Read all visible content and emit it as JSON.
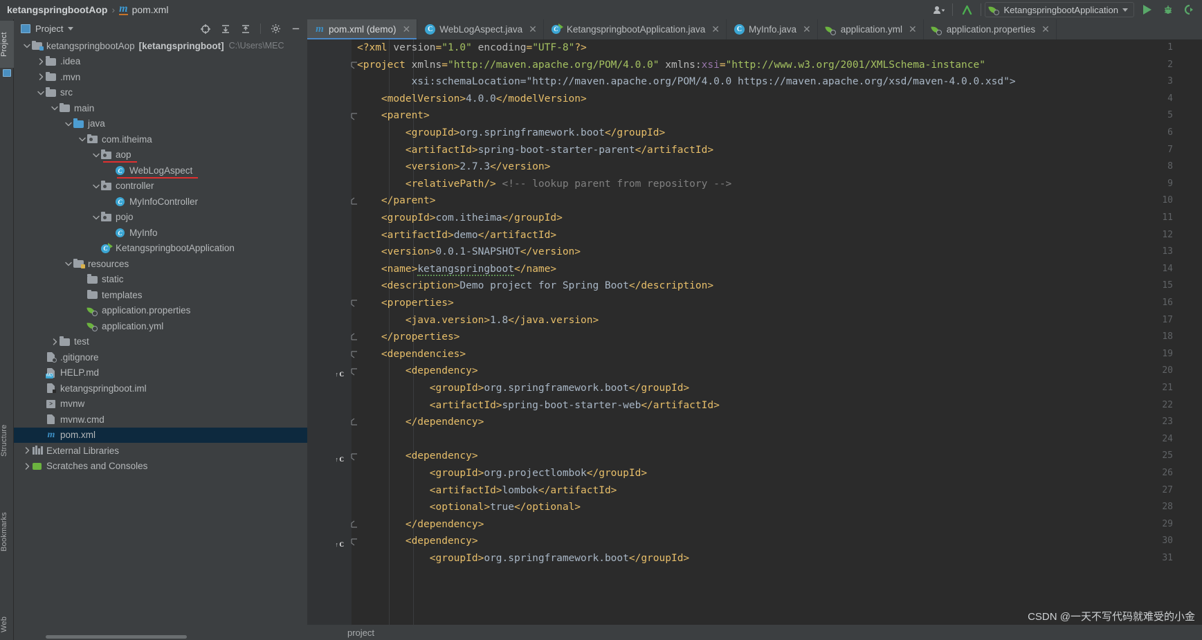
{
  "topbar": {
    "breadcrumb": {
      "project": "ketangspringbootAop",
      "separator": "›",
      "file": "pom.xml",
      "file_icon": "maven-m-icon"
    },
    "account_icon": "user-account-icon",
    "updates_icon": "update-arrow-icon",
    "run_config": {
      "label": "KetangspringbootApplication",
      "icon": "spring-leaf-icon",
      "dropdown_icon": "chevron-down-icon"
    },
    "run_icon": "run-play-icon",
    "debug_icon": "debug-bug-icon",
    "run_with_coverage_icon": "run-coverage-icon"
  },
  "left_strip": {
    "tabs": [
      {
        "label": "Project",
        "icon": "project-folder-icon",
        "selected": true
      },
      {
        "label": "Structure",
        "icon": "structure-icon",
        "selected": false
      },
      {
        "label": "Bookmarks",
        "icon": "bookmark-icon",
        "selected": false
      },
      {
        "label": "Web",
        "icon": "web-globe-icon",
        "selected": false
      }
    ]
  },
  "project_panel": {
    "title": "Project",
    "dropdown_icon": "chevron-down-icon",
    "toolbar_icons": [
      "locate-target-icon",
      "expand-all-icon",
      "collapse-all-icon",
      "gear-icon",
      "minimize-icon"
    ],
    "tree": [
      {
        "indent": 0,
        "arrow": "down",
        "icon": "module-folder-icon",
        "name": "ketangspringbootAop",
        "bold_suffix": "[ketangspringboot]",
        "path": "C:\\Users\\MEC",
        "selected": false
      },
      {
        "indent": 1,
        "arrow": "right",
        "icon": "folder-icon",
        "name": ".idea",
        "selected": false
      },
      {
        "indent": 1,
        "arrow": "right",
        "icon": "folder-icon",
        "name": ".mvn",
        "selected": false
      },
      {
        "indent": 1,
        "arrow": "down",
        "icon": "folder-icon",
        "name": "src",
        "selected": false
      },
      {
        "indent": 2,
        "arrow": "down",
        "icon": "folder-icon",
        "name": "main",
        "selected": false
      },
      {
        "indent": 3,
        "arrow": "down",
        "icon": "source-folder-icon",
        "name": "java",
        "selected": false
      },
      {
        "indent": 4,
        "arrow": "down",
        "icon": "package-icon",
        "name": "com.itheima",
        "selected": false
      },
      {
        "indent": 5,
        "arrow": "down",
        "icon": "package-icon",
        "name": "aop",
        "selected": false,
        "red_underline": true
      },
      {
        "indent": 6,
        "arrow": "none",
        "icon": "java-class-icon",
        "name": "WebLogAspect",
        "selected": false,
        "red_underline": true
      },
      {
        "indent": 5,
        "arrow": "down",
        "icon": "package-icon",
        "name": "controller",
        "selected": false
      },
      {
        "indent": 6,
        "arrow": "none",
        "icon": "java-class-icon",
        "name": "MyInfoController",
        "selected": false
      },
      {
        "indent": 5,
        "arrow": "down",
        "icon": "package-icon",
        "name": "pojo",
        "selected": false
      },
      {
        "indent": 6,
        "arrow": "none",
        "icon": "java-class-icon",
        "name": "MyInfo",
        "selected": false
      },
      {
        "indent": 5,
        "arrow": "none",
        "icon": "spring-boot-run-icon",
        "name": "KetangspringbootApplication",
        "selected": false
      },
      {
        "indent": 3,
        "arrow": "down",
        "icon": "resources-folder-icon",
        "name": "resources",
        "selected": false
      },
      {
        "indent": 4,
        "arrow": "none",
        "icon": "folder-icon",
        "name": "static",
        "selected": false
      },
      {
        "indent": 4,
        "arrow": "none",
        "icon": "folder-icon",
        "name": "templates",
        "selected": false
      },
      {
        "indent": 4,
        "arrow": "none",
        "icon": "spring-config-icon",
        "name": "application.properties",
        "selected": false
      },
      {
        "indent": 4,
        "arrow": "none",
        "icon": "spring-config-icon",
        "name": "application.yml",
        "selected": false
      },
      {
        "indent": 2,
        "arrow": "right",
        "icon": "folder-icon",
        "name": "test",
        "selected": false
      },
      {
        "indent": 1,
        "arrow": "none",
        "icon": "gitignore-icon",
        "name": ".gitignore",
        "selected": false
      },
      {
        "indent": 1,
        "arrow": "none",
        "icon": "markdown-icon",
        "name": "HELP.md",
        "selected": false
      },
      {
        "indent": 1,
        "arrow": "none",
        "icon": "iml-file-icon",
        "name": "ketangspringboot.iml",
        "selected": false
      },
      {
        "indent": 1,
        "arrow": "none",
        "icon": "shell-script-icon",
        "name": "mvnw",
        "selected": false
      },
      {
        "indent": 1,
        "arrow": "none",
        "icon": "cmd-file-icon",
        "name": "mvnw.cmd",
        "selected": false
      },
      {
        "indent": 1,
        "arrow": "none",
        "icon": "maven-m-icon",
        "name": "pom.xml",
        "selected": true
      },
      {
        "indent": 0,
        "arrow": "right",
        "icon": "external-libraries-icon",
        "name": "External Libraries",
        "selected": false
      },
      {
        "indent": 0,
        "arrow": "right",
        "icon": "scratches-icon",
        "name": "Scratches and Consoles",
        "selected": false
      }
    ]
  },
  "editor": {
    "tabs": [
      {
        "label": "pom.xml (demo)",
        "icon": "maven-m-icon",
        "active": true,
        "close_icon": "close-icon"
      },
      {
        "label": "WebLogAspect.java",
        "icon": "java-class-icon",
        "active": false,
        "close_icon": "close-icon"
      },
      {
        "label": "KetangspringbootApplication.java",
        "icon": "spring-boot-run-icon",
        "active": false,
        "close_icon": "close-icon"
      },
      {
        "label": "MyInfo.java",
        "icon": "java-class-icon",
        "active": false,
        "close_icon": "close-icon"
      },
      {
        "label": "application.yml",
        "icon": "spring-config-icon",
        "active": false,
        "close_icon": "close-icon"
      },
      {
        "label": "application.properties",
        "icon": "spring-config-icon",
        "active": false,
        "close_icon": "close-icon"
      }
    ],
    "first_line": 1,
    "last_line": 31,
    "gutter_markers": [
      {
        "line": 20,
        "icon": "spring-bean-nav-icon"
      },
      {
        "line": 25,
        "icon": "spring-bean-nav-icon"
      },
      {
        "line": 30,
        "icon": "spring-bean-nav-icon"
      }
    ],
    "folds": [
      {
        "line": 2,
        "type": "open"
      },
      {
        "line": 5,
        "type": "open"
      },
      {
        "line": 10,
        "type": "close"
      },
      {
        "line": 16,
        "type": "open"
      },
      {
        "line": 18,
        "type": "close"
      },
      {
        "line": 19,
        "type": "open"
      },
      {
        "line": 20,
        "type": "open"
      },
      {
        "line": 23,
        "type": "close"
      },
      {
        "line": 25,
        "type": "open"
      },
      {
        "line": 29,
        "type": "close"
      },
      {
        "line": 30,
        "type": "open"
      }
    ],
    "code_lines": [
      "<?xml version=\"1.0\" encoding=\"UTF-8\"?>",
      "<project xmlns=\"http://maven.apache.org/POM/4.0.0\" xmlns:xsi=\"http://www.w3.org/2001/XMLSchema-instance\"",
      "         xsi:schemaLocation=\"http://maven.apache.org/POM/4.0.0 https://maven.apache.org/xsd/maven-4.0.0.xsd\">",
      "    <modelVersion>4.0.0</modelVersion>",
      "    <parent>",
      "        <groupId>org.springframework.boot</groupId>",
      "        <artifactId>spring-boot-starter-parent</artifactId>",
      "        <version>2.7.3</version>",
      "        <relativePath/> <!-- lookup parent from repository -->",
      "    </parent>",
      "    <groupId>com.itheima</groupId>",
      "    <artifactId>demo</artifactId>",
      "    <version>0.0.1-SNAPSHOT</version>",
      "    <name>ketangspringboot</name>",
      "    <description>Demo project for Spring Boot</description>",
      "    <properties>",
      "        <java.version>1.8</java.version>",
      "    </properties>",
      "    <dependencies>",
      "        <dependency>",
      "            <groupId>org.springframework.boot</groupId>",
      "            <artifactId>spring-boot-starter-web</artifactId>",
      "        </dependency>",
      "",
      "        <dependency>",
      "            <groupId>org.projectlombok</groupId>",
      "            <artifactId>lombok</artifactId>",
      "            <optional>true</optional>",
      "        </dependency>",
      "        <dependency>",
      "            <groupId>org.springframework.boot</groupId>"
    ]
  },
  "status_bar": {
    "breadcrumb": "project"
  },
  "watermark": {
    "text": "CSDN @一天不写代码就难受的小金"
  },
  "colors": {
    "background": "#3c3f41",
    "editor_background": "#2b2b2b",
    "selection": "#0d293e",
    "accent_blue": "#4a88c7",
    "tag": "#e8bf6a",
    "string": "#a5c261",
    "text": "#a9b7c6",
    "comment": "#808080",
    "namespace": "#9876aa",
    "spring_green": "#6cb33f",
    "class_blue": "#3ba6d4",
    "red_underline": "#e03030"
  }
}
